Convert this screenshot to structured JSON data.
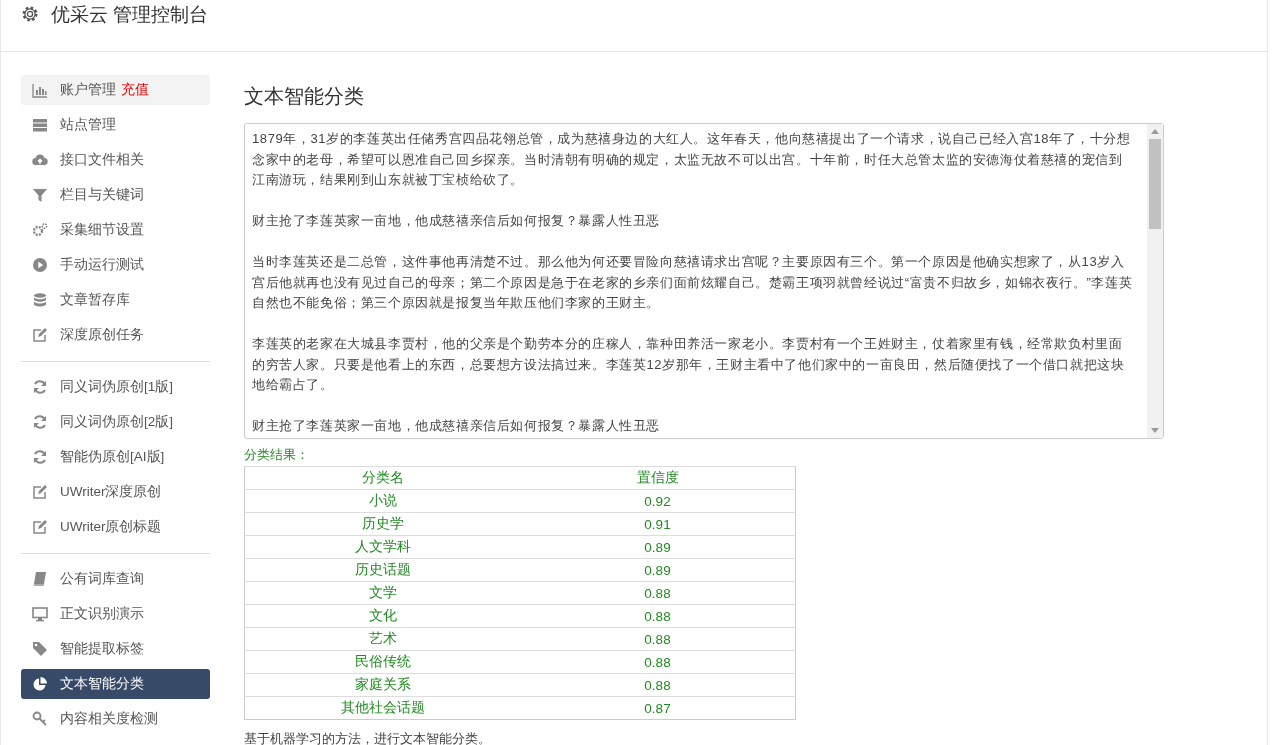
{
  "header": {
    "title": "优采云 管理控制台"
  },
  "sidebar": {
    "groups": [
      {
        "items": [
          {
            "label": "账户管理",
            "link": "充值",
            "hovered": true,
            "selected": false
          },
          {
            "label": "站点管理",
            "hovered": false,
            "selected": false
          },
          {
            "label": "接口文件相关",
            "hovered": false,
            "selected": false
          },
          {
            "label": "栏目与关键词",
            "hovered": false,
            "selected": false
          },
          {
            "label": "采集细节设置",
            "hovered": false,
            "selected": false
          },
          {
            "label": "手动运行测试",
            "hovered": false,
            "selected": false
          },
          {
            "label": "文章暂存库",
            "hovered": false,
            "selected": false
          },
          {
            "label": "深度原创任务",
            "hovered": false,
            "selected": false
          }
        ]
      },
      {
        "items": [
          {
            "label": "同义词伪原创[1版]",
            "hovered": false,
            "selected": false
          },
          {
            "label": "同义词伪原创[2版]",
            "hovered": false,
            "selected": false
          },
          {
            "label": "智能伪原创[AI版]",
            "hovered": false,
            "selected": false
          },
          {
            "label": "UWriter深度原创",
            "hovered": false,
            "selected": false
          },
          {
            "label": "UWriter原创标题",
            "hovered": false,
            "selected": false
          }
        ]
      },
      {
        "items": [
          {
            "label": "公有词库查询",
            "hovered": false,
            "selected": false
          },
          {
            "label": "正文识别演示",
            "hovered": false,
            "selected": false
          },
          {
            "label": "智能提取标签",
            "hovered": false,
            "selected": false
          },
          {
            "label": "文本智能分类",
            "hovered": false,
            "selected": true
          },
          {
            "label": "内容相关度检测",
            "hovered": false,
            "selected": false
          }
        ]
      }
    ]
  },
  "main": {
    "title": "文本智能分类",
    "text_area": {
      "paragraphs": [
        "1879年，31岁的李莲英出任储秀宫四品花翎总管，成为慈禧身边的大红人。这年春天，他向慈禧提出了一个请求，说自己已经入宫18年了，十分想念家中的老母，希望可以恩准自己回乡探亲。当时清朝有明确的规定，太监无故不可以出宫。十年前，时任大总管太监的安德海仗着慈禧的宠信到江南游玩，结果刚到山东就被丁宝桢给砍了。",
        "财主抢了李莲英家一亩地，他成慈禧亲信后如何报复？暴露人性丑恶",
        "当时李莲英还是二总管，这件事他再清楚不过。那么他为何还要冒险向慈禧请求出宫呢？主要原因有三个。第一个原因是他确实想家了，从13岁入宫后他就再也没有见过自己的母亲；第二个原因是急于在老家的乡亲们面前炫耀自己。楚霸王项羽就曾经说过“富贵不归故乡，如锦衣夜行。”李莲英自然也不能免俗；第三个原因就是报复当年欺压他们李家的王财主。",
        "李莲英的老家在大城县李贾村，他的父亲是个勤劳本分的庄稼人，靠种田养活一家老小。李贾村有一个王姓财主，仗着家里有钱，经常欺负村里面的穷苦人家。只要是他看上的东西，总要想方设法搞过来。李莲英12岁那年，王财主看中了他们家中的一亩良田，然后随便找了一个借口就把这块地给霸占了。",
        "财主抢了李莲英家一亩地，他成慈禧亲信后如何报复？暴露人性丑恶"
      ]
    },
    "result_label": "分类结果：",
    "table": {
      "columns": [
        "分类名",
        "置信度"
      ],
      "rows": [
        [
          "小说",
          "0.92"
        ],
        [
          "历史学",
          "0.91"
        ],
        [
          "人文学科",
          "0.89"
        ],
        [
          "历史话题",
          "0.89"
        ],
        [
          "文学",
          "0.88"
        ],
        [
          "文化",
          "0.88"
        ],
        [
          "艺术",
          "0.88"
        ],
        [
          "民俗传统",
          "0.88"
        ],
        [
          "家庭关系",
          "0.88"
        ],
        [
          "其他社会话题",
          "0.87"
        ]
      ]
    },
    "footnote": "基于机器学习的方法，进行文本智能分类。"
  }
}
